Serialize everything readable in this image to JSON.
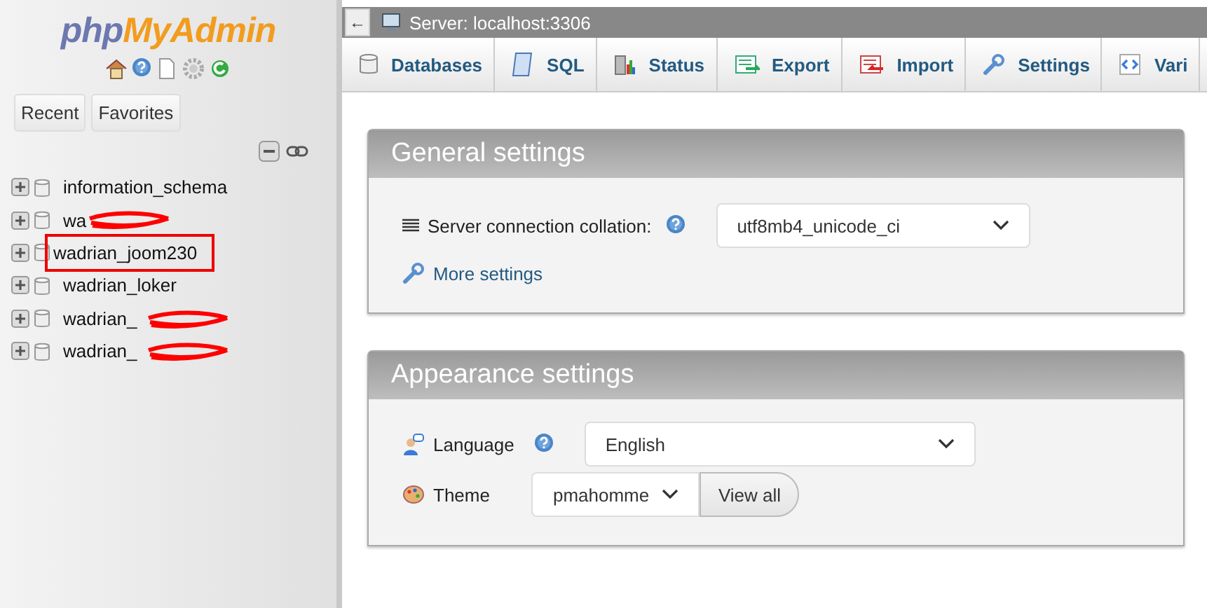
{
  "logo": {
    "part_1": "php",
    "part_2": "MyAdmin"
  },
  "nav_buttons": [
    "Recent",
    "Favorites"
  ],
  "databases": [
    {
      "name": "information_schema",
      "redacted": false,
      "highlighted": false
    },
    {
      "name": "wa",
      "redacted": true,
      "highlighted": false
    },
    {
      "name": "wadrian_joom230",
      "redacted": false,
      "highlighted": true
    },
    {
      "name": "wadrian_loker",
      "redacted": false,
      "highlighted": false
    },
    {
      "name": "wadrian_",
      "redacted": true,
      "highlighted": false
    },
    {
      "name": "wadrian_",
      "redacted": true,
      "highlighted": false
    }
  ],
  "top_bar": {
    "back": "←",
    "title": "Server: localhost:3306"
  },
  "tabs": [
    {
      "label": "Databases",
      "kind": "db"
    },
    {
      "label": "SQL",
      "kind": "sql"
    },
    {
      "label": "Status",
      "kind": "status"
    },
    {
      "label": "Export",
      "kind": "export"
    },
    {
      "label": "Import",
      "kind": "import"
    },
    {
      "label": "Settings",
      "kind": "settings"
    },
    {
      "label": "Vari",
      "kind": "vars"
    }
  ],
  "general_settings": {
    "title": "General settings",
    "collation_label": "Server connection collation:",
    "collation_value": "utf8mb4_unicode_ci",
    "more_link": "More settings"
  },
  "appearance_settings": {
    "title": "Appearance settings",
    "language_label": "Language",
    "language_value": "English",
    "theme_label": "Theme",
    "theme_value": "pmahomme",
    "view_all": "View all"
  }
}
